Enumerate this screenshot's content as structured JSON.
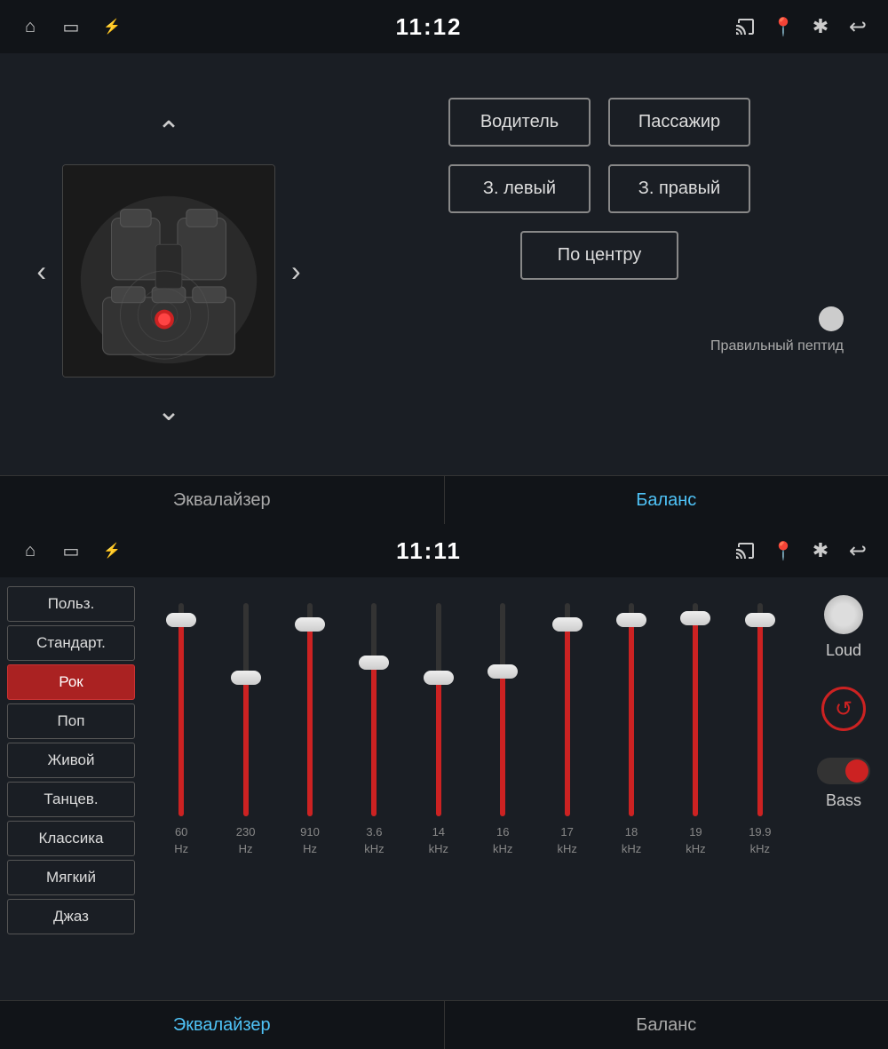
{
  "topPanel": {
    "statusBar": {
      "time": "11:12",
      "icons": {
        "home": "⌂",
        "screen": "▭",
        "usb": "⚡",
        "cast": "⊡",
        "location": "📍",
        "bluetooth": "✱",
        "back": "↩"
      }
    },
    "buttons": {
      "driver": "Водитель",
      "passenger": "Пассажир",
      "rearLeft": "З. левый",
      "rearRight": "З. правый",
      "center": "По центру"
    },
    "indicator": {
      "text": "Правильный пептид"
    },
    "tabs": [
      {
        "label": "Эквалайзер",
        "active": false
      },
      {
        "label": "Баланс",
        "active": true
      }
    ]
  },
  "bottomPanel": {
    "statusBar": {
      "time": "11:11"
    },
    "presets": [
      {
        "label": "Польз.",
        "active": false
      },
      {
        "label": "Стандарт.",
        "active": false
      },
      {
        "label": "Рок",
        "active": true
      },
      {
        "label": "Поп",
        "active": false
      },
      {
        "label": "Живой",
        "active": false
      },
      {
        "label": "Танцев.",
        "active": false
      },
      {
        "label": "Классика",
        "active": false
      },
      {
        "label": "Мягкий",
        "active": false
      },
      {
        "label": "Джаз",
        "active": false
      }
    ],
    "sliders": [
      {
        "freq": "60",
        "unit": "Hz",
        "fillPct": 92
      },
      {
        "freq": "230",
        "unit": "Hz",
        "fillPct": 65
      },
      {
        "freq": "910",
        "unit": "Hz",
        "fillPct": 90
      },
      {
        "freq": "3.6",
        "unit": "kHz",
        "fillPct": 72
      },
      {
        "freq": "14",
        "unit": "kHz",
        "fillPct": 65
      },
      {
        "freq": "16",
        "unit": "kHz",
        "fillPct": 68
      },
      {
        "freq": "17",
        "unit": "kHz",
        "fillPct": 90
      },
      {
        "freq": "18",
        "unit": "kHz",
        "fillPct": 92
      },
      {
        "freq": "19",
        "unit": "kHz",
        "fillPct": 93
      },
      {
        "freq": "19.9",
        "unit": "kHz",
        "fillPct": 92
      }
    ],
    "controls": {
      "loud": "Loud",
      "bass": "Bass"
    },
    "tabs": [
      {
        "label": "Эквалайзер",
        "active": true
      },
      {
        "label": "Баланс",
        "active": false
      }
    ]
  }
}
